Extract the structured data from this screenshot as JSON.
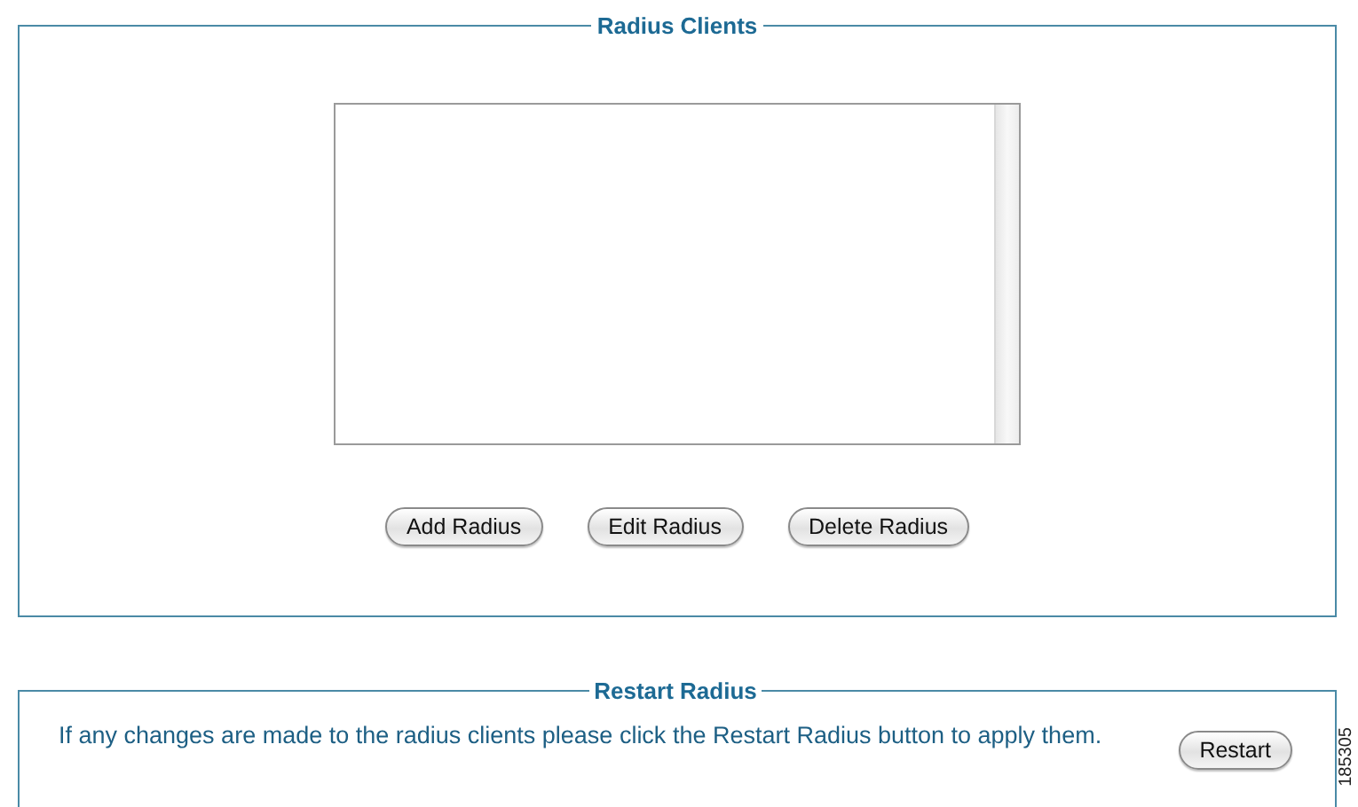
{
  "radius_clients": {
    "title": "Radius Clients",
    "buttons": [
      "Add Radius",
      "Edit Radius",
      "Delete Radius"
    ]
  },
  "restart_radius": {
    "title": "Restart Radius",
    "message": "If any changes are made to the radius clients please click the Restart Radius button to apply them.",
    "button": "Restart"
  },
  "figure_id": "185305"
}
